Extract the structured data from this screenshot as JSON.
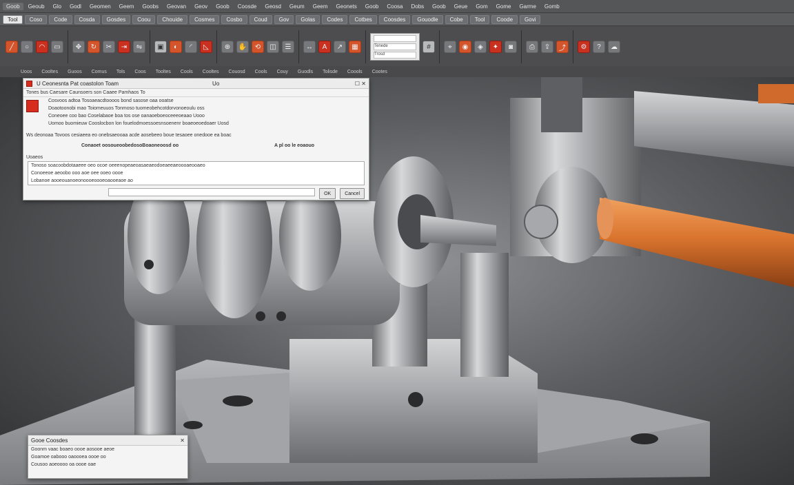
{
  "ribbon": {
    "menu": [
      "Goob",
      "Geoub",
      "Glo",
      "Godl",
      "Geomen",
      "Geem",
      "Goobs",
      "Geovan",
      "Geov",
      "Goob",
      "Coosde",
      "Geosd",
      "Geum",
      "Geem",
      "Geonets",
      "Goob",
      "Coosa",
      "Dobs",
      "Goob",
      "Geue",
      "Gom",
      "Gome",
      "Garme",
      "Gomb"
    ],
    "tabs": [
      "Tool",
      "Coso",
      "Code",
      "Cosda",
      "Gosdes",
      "Coou",
      "Chouide",
      "Cosmes",
      "Cosbo",
      "Coud",
      "Gov",
      "Golas",
      "Codes",
      "Cotbes",
      "Coosdes",
      "Gouodle",
      "Cobe",
      "Tool",
      "Coode",
      "Govi"
    ],
    "group_labels": [
      "Uoos",
      "Cooltes",
      "Guoos",
      "Comus",
      "Tols",
      "Coos",
      "Tooltes",
      "Cools",
      "Cooltes",
      "Couosd",
      "Cools",
      "Couy",
      "Guodls",
      "Tolisde",
      "Coools",
      "Cootes"
    ],
    "properties": {
      "field1": "Tenede",
      "field2": "Trosd"
    },
    "colors": {
      "accent": "#d4542c",
      "red": "#c9301f",
      "ribbon_bg": "#4d4d4f"
    }
  },
  "dialog_main": {
    "title": "U Ceonesnta Pat coastolon Toam",
    "title_right": "Uo",
    "header_line": "Tones bus Caesare  Caunsoers son Caaee  Pamhaos  To",
    "rows": [
      "Cosvoos adtoa  Tosoaeacdtoooos bond sasose oaa ooatse",
      "Doaotoonobi mao  Toiomeuuos  Tonmoso tuomeobehcotdorvonoeoulu oss",
      "Coneoee coo bao  Coselabaoe boa tos ose oanaoeboeoceeeoeaao   Uooo",
      "Uomoo buomieuw  Cooslocbon lon fouelodmoessoesnsoenenr boaeoeoedoaer   Uosd"
    ],
    "note": "Ws deonoaa Tovoos cesiaeea eo onebsaeooaa acde aosebeeo boue tesaoee onedooe ea boac",
    "section_left": "Conaoet oosoueoobedosoBoaoneoosd oo",
    "section_right": "A pl oo le eoaouo",
    "group_label": "Uoaeos",
    "list_items": [
      "Tonoso  soacoobdotaaeee oeo ocoe oeeenopeaeoasaeaeodoeaeeaeoooaeooaeo",
      "Conoeeoe aeoobo ooo aoe oee ooeo oooe",
      "Lobanoe  aooeouanoeonoooeoooeoaooeaoe  ao"
    ],
    "button_ok": "OK",
    "button_cancel": "Cancel"
  },
  "dialog_small": {
    "title": "Gooe  Coosdes",
    "rows": [
      "Goonm  vaac boaeo oooe aosooe aeoe",
      "Goamoe oabooo oaoooea oooe  oo",
      "Cousoo  aoeoooo  oa oooe oae"
    ]
  },
  "scene": {
    "description_hidden": ""
  }
}
